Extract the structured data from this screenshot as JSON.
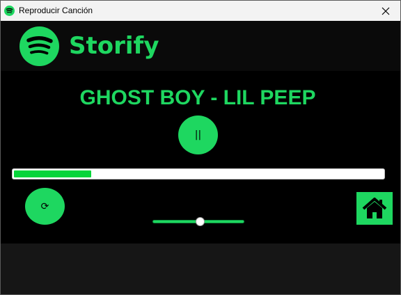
{
  "window": {
    "title": "Reproducir Canción",
    "icon": "spotify-icon",
    "close_icon": "close-icon"
  },
  "header": {
    "brand": "Storify",
    "logo_icon": "spotify-logo-icon"
  },
  "player": {
    "song_title": "GHOST BOY - LIL PEEP",
    "pause_label": "||",
    "repeat_label": "⟳",
    "progress_percent": 21,
    "volume_percent": 52,
    "home_icon": "home-icon"
  },
  "colors": {
    "accent": "#1ed760",
    "progress": "#06d53a",
    "background": "#000000"
  }
}
